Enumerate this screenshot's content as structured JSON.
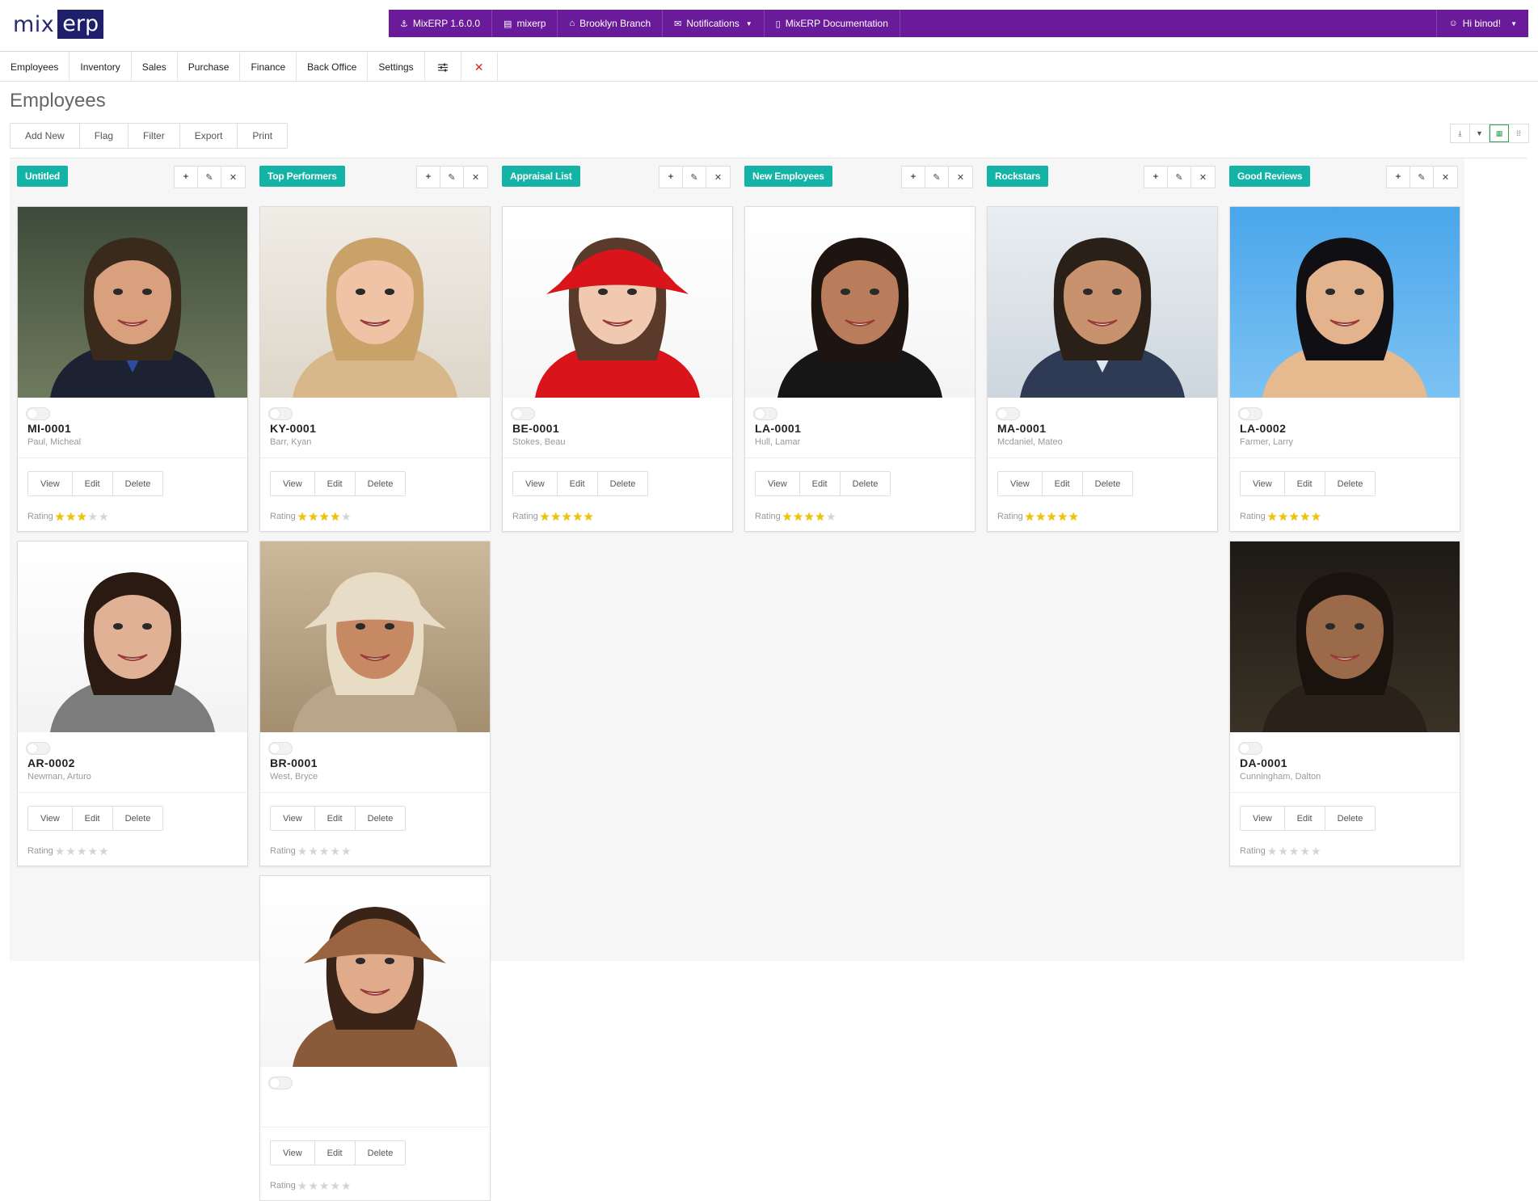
{
  "app": {
    "logo_mix": "mix",
    "logo_erp": "erp",
    "version": "MixERP 1.6.0.0",
    "database": "mixerp",
    "branch": "Brooklyn Branch",
    "notifications": "Notifications",
    "documentation": "MixERP Documentation",
    "user": "Hi binod!"
  },
  "menu": [
    "Employees",
    "Inventory",
    "Sales",
    "Purchase",
    "Finance",
    "Back Office",
    "Settings"
  ],
  "page": {
    "title": "Employees"
  },
  "toolbar": [
    "Add New",
    "Flag",
    "Filter",
    "Export",
    "Print"
  ],
  "card_actions": {
    "view": "View",
    "edit": "Edit",
    "delete": "Delete"
  },
  "rating_label": "Rating",
  "columns": [
    {
      "title": "Untitled",
      "cards": [
        {
          "code": "MI-0001",
          "name": "Paul, Micheal",
          "rating": 3,
          "photo": "man-suit-outdoors"
        },
        {
          "code": "AR-0002",
          "name": "Newman, Arturo",
          "rating": 0,
          "photo": "woman-grey-top"
        }
      ]
    },
    {
      "title": "Top Performers",
      "cards": [
        {
          "code": "KY-0001",
          "name": "Barr, Kyan",
          "rating": 4,
          "photo": "blonde-woman"
        },
        {
          "code": "BR-0001",
          "name": "West, Bryce",
          "rating": 0,
          "photo": "man-cowboy-hat"
        },
        {
          "code": "",
          "name": "",
          "rating": 0,
          "photo": "woman-brown-cap"
        }
      ]
    },
    {
      "title": "Appraisal List",
      "cards": [
        {
          "code": "BE-0001",
          "name": "Stokes, Beau",
          "rating": 5,
          "photo": "woman-red-hat"
        }
      ]
    },
    {
      "title": "New Employees",
      "cards": [
        {
          "code": "LA-0001",
          "name": "Hull, Lamar",
          "rating": 4,
          "photo": "woman-dark-hair"
        }
      ]
    },
    {
      "title": "Rockstars",
      "cards": [
        {
          "code": "MA-0001",
          "name": "Mcdaniel, Mateo",
          "rating": 5,
          "photo": "man-business-suit"
        }
      ]
    },
    {
      "title": "Good Reviews",
      "cards": [
        {
          "code": "LA-0002",
          "name": "Farmer, Larry",
          "rating": 5,
          "photo": "man-blue-background"
        },
        {
          "code": "DA-0001",
          "name": "Cunningham, Dalton",
          "rating": 0,
          "photo": "woman-dark-portrait"
        }
      ]
    }
  ],
  "colors": {
    "purple_bar": "#6a1b9a",
    "tag": "#13b3a5",
    "star": "#f2c400",
    "logo": "#1f1f6b"
  }
}
